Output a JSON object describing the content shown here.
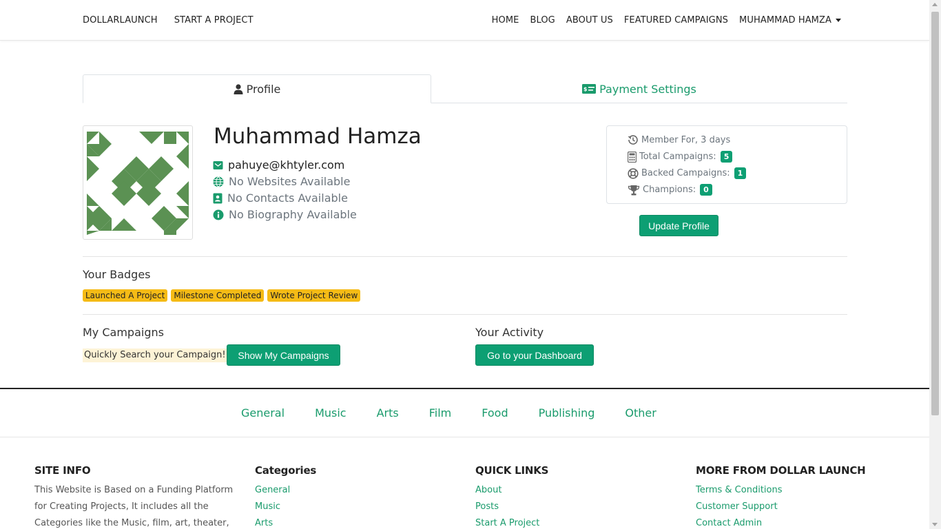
{
  "nav": {
    "brand": "DOLLARLAUNCH",
    "start": "START A PROJECT",
    "home": "HOME",
    "blog": "BLOG",
    "about": "ABOUT US",
    "featured": "FEATURED CAMPAIGNS",
    "user": "MUHAMMAD HAMZA"
  },
  "tabs": {
    "profile": "Profile",
    "payment": "Payment Settings"
  },
  "profile": {
    "name": "Muhammad Hamza",
    "email": "pahuye@khtyler.com",
    "websites": "No Websites Available",
    "contacts": "No Contacts Available",
    "biography": "No Biography Available"
  },
  "stats": {
    "member_for": "Member For, 3 days",
    "total_campaigns_label": "Total Campaigns:",
    "total_campaigns": "5",
    "backed_label": "Backed Campaigns:",
    "backed": "1",
    "champions_label": "Champions:",
    "champions": "0"
  },
  "update_profile": "Update Profile",
  "badges": {
    "title": "Your Badges",
    "items": [
      "Launched A Project",
      "Milestone Completed",
      "Wrote Project Review"
    ]
  },
  "campaigns": {
    "title": "My Campaigns",
    "hint": "Quickly Search your Campaign!",
    "button": "Show My Campaigns"
  },
  "activity": {
    "title": "Your Activity",
    "button": "Go to your Dashboard"
  },
  "categories_bar": [
    "General",
    "Music",
    "Arts",
    "Film",
    "Food",
    "Publishing",
    "Other"
  ],
  "footer": {
    "site_info": {
      "title": "SITE INFO",
      "lines": [
        "This Website is Based on a Funding Platform",
        "for Creating Projects, It includes all the",
        "Categories like the Music, film, art, theater,"
      ]
    },
    "categories": {
      "title": "Categories",
      "links": [
        "General",
        "Music",
        "Arts"
      ]
    },
    "quick_links": {
      "title": "QUICK LINKS",
      "links": [
        "About",
        "Posts",
        "Start A Project"
      ]
    },
    "more": {
      "title": "MORE FROM DOLLAR LAUNCH",
      "links": [
        "Terms & Conditions",
        "Customer Support",
        "Contact Admin"
      ]
    }
  },
  "colors": {
    "accent": "#0d9f73",
    "link": "#1a9b6c",
    "badge": "#f5bb16",
    "avatar": "#5b9153"
  }
}
